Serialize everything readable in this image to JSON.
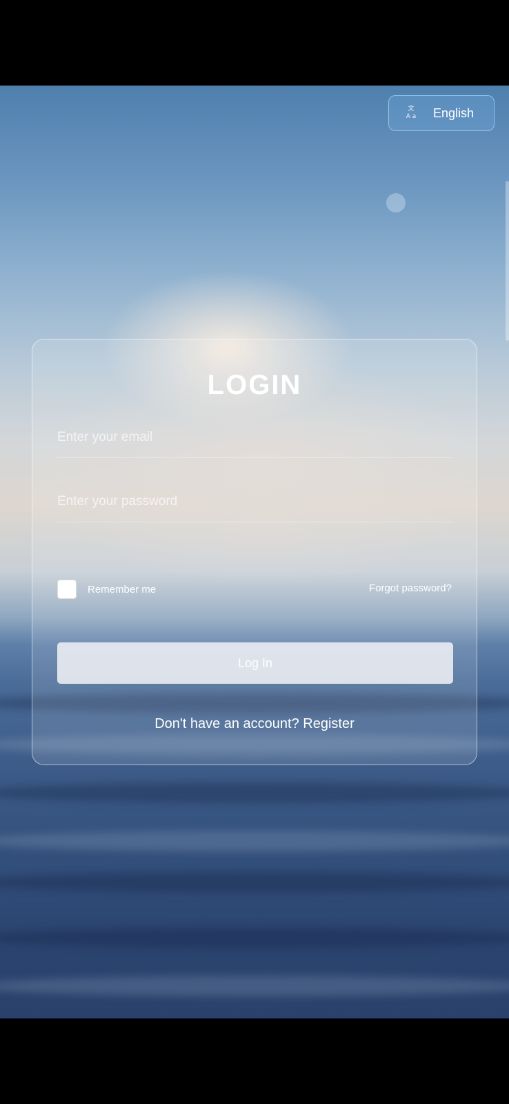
{
  "language": {
    "icon": "translate-icon",
    "icon_top": "文",
    "icon_bottom": "A a",
    "label": "English"
  },
  "login": {
    "title": "LOGIN",
    "email_placeholder": "Enter your email",
    "password_placeholder": "Enter your password",
    "remember_label": "Remember me",
    "remember_checked": false,
    "forgot_label": "Forgot password?",
    "submit_label": "Log In",
    "no_account_text": "Don't have an account?",
    "register_label": "Register"
  }
}
